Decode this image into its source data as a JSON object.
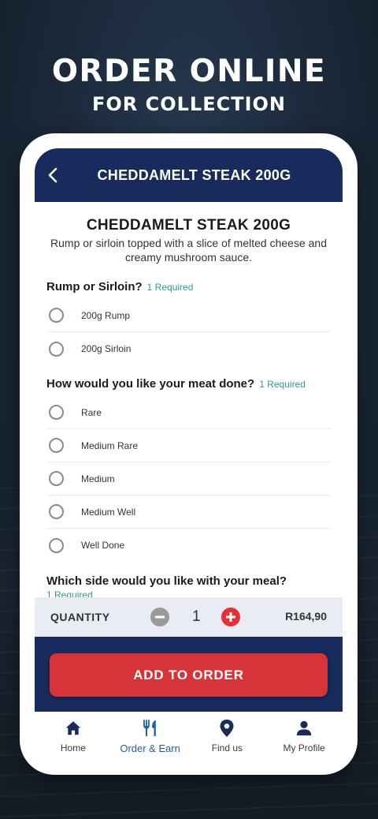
{
  "promo": {
    "headline": "ORDER ONLINE",
    "subheadline": "FOR COLLECTION"
  },
  "header": {
    "title": "CHEDDAMELT STEAK 200G",
    "back_icon": "chevron-left-icon"
  },
  "product": {
    "title": "CHEDDAMELT STEAK 200G",
    "description": "Rump or sirloin topped with a slice of melted cheese and creamy mushroom sauce."
  },
  "groups": [
    {
      "question": "Rump or Sirloin?",
      "required": "1 Required",
      "options": [
        "200g Rump",
        "200g Sirloin"
      ]
    },
    {
      "question": "How would you like your meat done?",
      "required": "1 Required",
      "options": [
        "Rare",
        "Medium Rare",
        "Medium",
        "Medium Well",
        "Well Done"
      ]
    },
    {
      "question": "Which side would you like with your meal?",
      "required": "1 Required"
    }
  ],
  "quantity": {
    "label": "QUANTITY",
    "value": "1",
    "price": "R164,90"
  },
  "cta": {
    "label": "ADD TO ORDER"
  },
  "tabs": [
    {
      "label": "Home",
      "icon": "home-icon"
    },
    {
      "label": "Order & Earn",
      "icon": "cutlery-icon",
      "active": true
    },
    {
      "label": "Find us",
      "icon": "map-pin-icon"
    },
    {
      "label": "My Profile",
      "icon": "user-icon"
    }
  ],
  "colors": {
    "brand_navy": "#172b5c",
    "accent_red": "#d63439",
    "required_green": "#2aa082",
    "active_tab_blue": "#1f5ea8"
  }
}
